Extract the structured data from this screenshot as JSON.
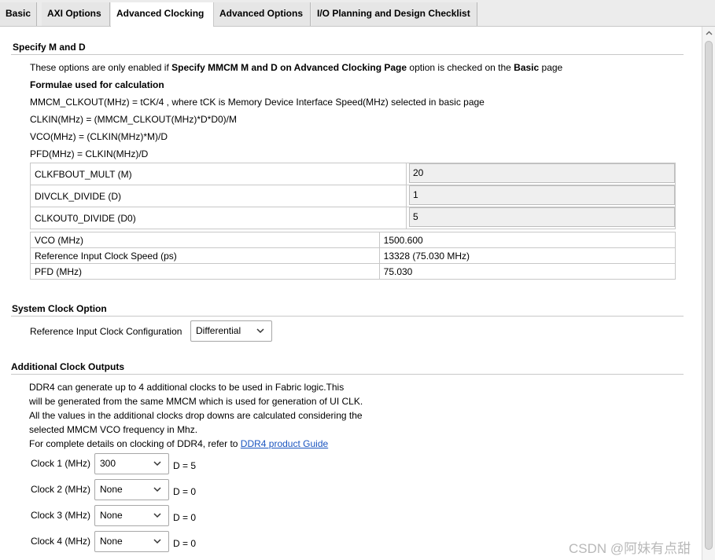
{
  "tabs": [
    {
      "label": "Basic"
    },
    {
      "label": "AXI Options"
    },
    {
      "label": "Advanced Clocking"
    },
    {
      "label": "Advanced Options"
    },
    {
      "label": "I/O Planning and Design Checklist"
    }
  ],
  "specify": {
    "title": "Specify M and D",
    "note": {
      "prefix": "These options are only enabled if ",
      "bold1": "Specify MMCM M and D on Advanced Clocking Page",
      "middle": " option is checked on the ",
      "bold2": "Basic",
      "suffix": " page"
    },
    "formula_title": "Formulae used for calculation",
    "formulas": [
      "MMCM_CLKOUT(MHz) = tCK/4 , where tCK is Memory Device Interface Speed(MHz) selected in basic page",
      "CLKIN(MHz) = (MMCM_CLKOUT(MHz)*D*D0)/M",
      "VCO(MHz) = (CLKIN(MHz)*M)/D",
      "PFD(MHz) = CLKIN(MHz)/D"
    ],
    "params": [
      {
        "label": "CLKFBOUT_MULT (M)",
        "value": "20"
      },
      {
        "label": "DIVCLK_DIVIDE (D)",
        "value": "1"
      },
      {
        "label": "CLKOUT0_DIVIDE (D0)",
        "value": "5"
      }
    ],
    "results": [
      {
        "label": "VCO (MHz)",
        "value": "1500.600"
      },
      {
        "label": "Reference Input Clock Speed (ps)",
        "value": "13328 (75.030 MHz)"
      },
      {
        "label": "PFD (MHz)",
        "value": "75.030"
      }
    ]
  },
  "system_clock": {
    "title": "System Clock Option",
    "label": "Reference Input Clock Configuration",
    "value": "Differential"
  },
  "additional": {
    "title": "Additional Clock Outputs",
    "lines": [
      "DDR4 can generate up to 4 additional clocks to be used in Fabric logic.This",
      "will be generated from the same MMCM which is used for generation of UI CLK.",
      "All the values in the additional clocks drop downs are calculated considering the",
      "selected MMCM VCO frequency in Mhz."
    ],
    "ref_prefix": "For complete details on clocking of DDR4, refer to ",
    "ref_link": "DDR4 product Guide",
    "clocks": [
      {
        "label": "Clock 1 (MHz)",
        "value": "300",
        "d": "D = 5"
      },
      {
        "label": "Clock 2 (MHz)",
        "value": "None",
        "d": "D = 0"
      },
      {
        "label": "Clock 3 (MHz)",
        "value": "None",
        "d": "D = 0"
      },
      {
        "label": "Clock 4 (MHz)",
        "value": "None",
        "d": "D = 0"
      }
    ]
  },
  "watermark": "CSDN @阿妹有点甜"
}
